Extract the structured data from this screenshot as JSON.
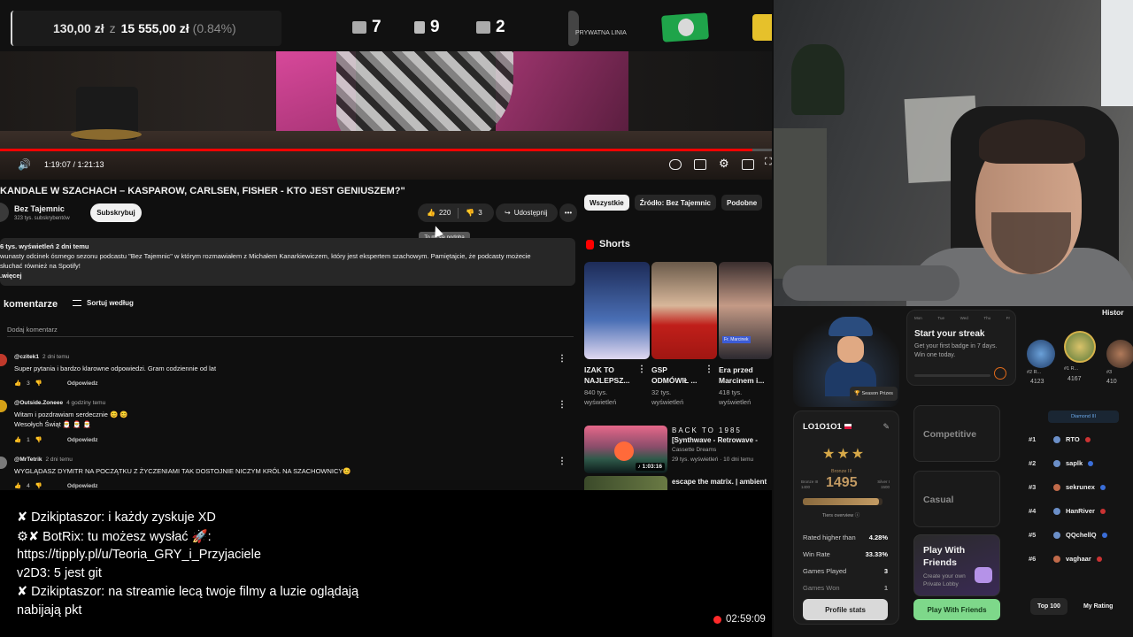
{
  "overlay": {
    "donation_current": "130,00 zł",
    "donation_sep": "z",
    "donation_goal": "15 555,00 zł",
    "donation_pct": "(0.84%)",
    "stats": [
      {
        "icon": "youtube-icon",
        "value": "7"
      },
      {
        "icon": "kick-icon",
        "value": "9"
      },
      {
        "icon": "twitch-icon",
        "value": "2"
      }
    ],
    "sponsor_label": "PRYWATNA LINIA"
  },
  "player": {
    "time": "1:19:07 / 1:21:13",
    "progress_fraction": 0.975
  },
  "video": {
    "title": "KANDALE W SZACHACH – KASPAROW, CARLSEN, FISHER - KTO JEST GENIUSZEM?\"",
    "channel": "Bez Tajemnic",
    "subscribers": "323 tys. subskrybentów",
    "subscribe_label": "Subskrybuj",
    "likes": "220",
    "dislikes": "3",
    "share_label": "Udostępnij",
    "more_label": "•••",
    "tooltip": "To mi się podoba"
  },
  "description": {
    "meta": "6 tys. wyświetleń  2 dni temu",
    "line1": "wunasty odcinek ósmego sezonu podcastu \"Bez Tajemnic\" w którym rozmawiałem z Michałem Kanarkiewiczem, który jest ekspertem szachowym. Pamiętajcie, że podcasty możecie",
    "line2": "słuchać również na Spotify!",
    "more": ".więcej"
  },
  "comments": {
    "header": "komentarze",
    "sort_label": "Sortuj według",
    "add_placeholder": "Dodaj komentarz",
    "reply_label": "Odpowiedz",
    "items": [
      {
        "author": "@czitek1",
        "when": "2 dni temu",
        "text1": "Super pytania i bardzo klarowne odpowiedzi. Gram codziennie od lat",
        "text2": "",
        "likes": "3",
        "avatar_color": "#c0392b"
      },
      {
        "author": "@Outside.Zoneee",
        "when": "4 godziny temu",
        "text1": "Witam i pozdrawiam serdecznie 😊 😊",
        "text2": "Wesołych Świąt 🎅 🎅 🎅",
        "likes": "1",
        "avatar_color": "#d4a017"
      },
      {
        "author": "@MrTetrik",
        "when": "2 dni temu",
        "text1": "WYGLĄDASZ DYMITR NA POCZĄTKU Z ŻYCZENIAMI TAK DOSTOJNIE NICZYM KRÓL NA SZACHOWNICY😊",
        "text2": "",
        "likes": "4",
        "avatar_color": "#7a7a7a"
      }
    ]
  },
  "related": {
    "chips": [
      "Wszystkie",
      "Źródło: Bez Tajemnic",
      "Podobne"
    ],
    "shorts_label": "Shorts",
    "shorts": [
      {
        "title1": "IZAK TO",
        "title2": "NAJLEPSZ...",
        "views1": "840 tys.",
        "views2": "wyświetleń",
        "bg": "#2b3c6e"
      },
      {
        "title1": "GSP",
        "title2": "ODMÓWIŁ ...",
        "views1": "32 tys.",
        "views2": "wyświetleń",
        "bg": "#b4231e"
      },
      {
        "title1": "Era przed",
        "title2": "Marcinem i...",
        "views1": "418 tys.",
        "views2": "wyświetleń",
        "bg": "#5a4a52"
      }
    ],
    "short3_tag": "Fr. Marcinek",
    "video1": {
      "title1": "BACK TO 1985",
      "title2": "[Synthwave - Retrowave -",
      "channel": "Cassette Dreams",
      "meta": "29 tys. wyświetleń · 10 dni temu",
      "duration": "1:03:16"
    },
    "video2": {
      "title1": "escape the matrix. | ambient"
    }
  },
  "chat": {
    "lines": [
      "✘ Dzikiptaszor: i każdy zyskuje XD",
      "⚙✘ BotRix: tu możesz wysłać 🚀:",
      "https://tipply.pl/u/Teoria_GRY_i_Przyjaciele",
      "v2D3: 5 jest git",
      "✘ Dzikiptaszor: na streamie lecą twoje filmy a luzie oglądają",
      "nabijają pkt"
    ],
    "recording_time": "02:59:09"
  },
  "game": {
    "season_prizes": "Season Prizes",
    "player_name": "LO1O1O1",
    "rank_label": "Bronze III",
    "elo": "1495",
    "elo_left": "Bronze III 1400",
    "elo_right": "Silver I 1500",
    "elo_fraction": 0.95,
    "tiers_label": "Tiers overview",
    "stats": [
      {
        "label": "Rated higher than",
        "value": "4.28%"
      },
      {
        "label": "Win Rate",
        "value": "33.33%"
      },
      {
        "label": "Games Played",
        "value": "3"
      },
      {
        "label": "Games Won",
        "value": "1"
      }
    ],
    "profile_button": "Profile stats",
    "streak_days": [
      "Mon",
      "Tue",
      "Wed",
      "Thu",
      "Fr"
    ],
    "streak_title": "Start your streak",
    "streak_text": "Get your first badge in 7 days. Win one today.",
    "modes": [
      "Competitive",
      "Casual"
    ],
    "friends_title": "Play With Friends",
    "friends_text": "Create your own Private Lobby",
    "friends_button": "Play With Friends",
    "history_label": "Histor",
    "top3": [
      {
        "name": "#2 R...",
        "score": "4123"
      },
      {
        "name": "#1 R...",
        "score": "4167"
      },
      {
        "name": "#3",
        "score": "410"
      }
    ],
    "division": "Diamond III",
    "leaderboard": [
      {
        "rank": "#1",
        "name": "RTO"
      },
      {
        "rank": "#2",
        "name": "saplk"
      },
      {
        "rank": "#3",
        "name": "sekrunex"
      },
      {
        "rank": "#4",
        "name": "HanRiver"
      },
      {
        "rank": "#5",
        "name": "QQchellQ"
      },
      {
        "rank": "#6",
        "name": "vaghaar"
      }
    ],
    "tabs": [
      "Top 100",
      "My Rating"
    ]
  }
}
